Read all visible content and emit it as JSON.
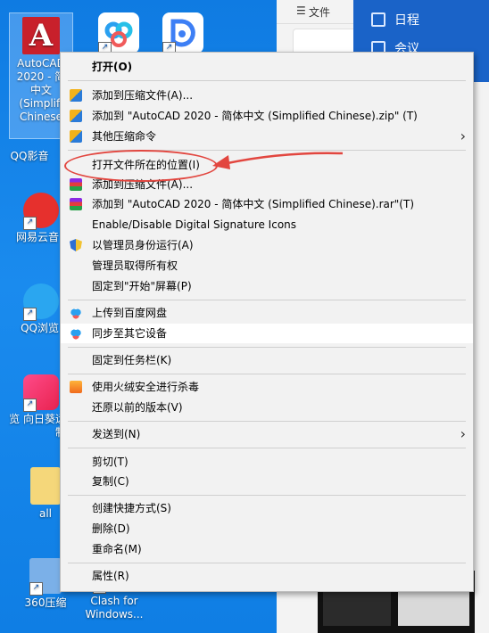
{
  "desktop": {
    "icons": [
      {
        "label": "AutoCAD\n2020 - 简\n中文\n(Simplifi\nChinese"
      },
      {
        "label": "QQ影音"
      },
      {
        "label": "网易云音"
      },
      {
        "label": "QQ浏览"
      },
      {
        "label": "览 向日葵远\n制"
      },
      {
        "label": "all"
      },
      {
        "label": "360压缩"
      },
      {
        "label": "Clash for\nWindows..."
      }
    ],
    "shortcut_glyph": "↗"
  },
  "right_panel": {
    "tab_label": "文件",
    "calendar_label": "日程",
    "meeting_label": "会议"
  },
  "context_menu": {
    "open": "打开(O)",
    "add_to_archive_zip": "添加到压缩文件(A)...",
    "add_to_named_zip": "添加到 \"AutoCAD 2020 - 简体中文 (Simplified Chinese).zip\" (T)",
    "other_compress": "其他压缩命令",
    "open_file_location": "打开文件所在的位置(I)",
    "add_to_archive_rar": "添加到压缩文件(A)...",
    "add_to_named_rar": "添加到 \"AutoCAD 2020 - 简体中文 (Simplified Chinese).rar\"(T)",
    "digital_signature": "Enable/Disable Digital Signature Icons",
    "run_as_admin": "以管理员身份运行(A)",
    "take_ownership": "管理员取得所有权",
    "pin_start": "固定到\"开始\"屏幕(P)",
    "upload_baidu": "上传到百度网盘",
    "sync_devices": "同步至其它设备",
    "pin_taskbar": "固定到任务栏(K)",
    "huorong_scan": "使用火绒安全进行杀毒",
    "restore_versions": "还原以前的版本(V)",
    "send_to": "发送到(N)",
    "cut": "剪切(T)",
    "copy": "复制(C)",
    "create_shortcut": "创建快捷方式(S)",
    "delete": "删除(D)",
    "rename": "重命名(M)",
    "properties": "属性(R)",
    "submenu_arrow": "›"
  },
  "colors": {
    "desktop_bg": "#1784e6",
    "annotation": "#e2463f",
    "menu_bg": "#f2f2f2",
    "highlight": "#ffffff"
  }
}
